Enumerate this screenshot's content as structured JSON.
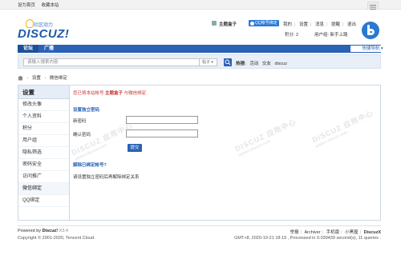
{
  "topbar": {
    "links": [
      "设为首页",
      "收藏本站"
    ]
  },
  "logo": {
    "brand": "DISCUZ!",
    "subtitle": "社区动力"
  },
  "user": {
    "name": "主题盒子",
    "qq_bind": "QQ帐号绑定",
    "links": [
      "我的",
      "设置",
      "消息",
      "提醒",
      "退出"
    ],
    "points_label": "积分: 2",
    "group_label": "用户组: 新手上路"
  },
  "nav": {
    "items": [
      "论坛",
      "广播"
    ],
    "quick_nav": "快捷导航"
  },
  "search": {
    "placeholder": "请输入搜索内容",
    "select": "帖子",
    "hot_label": "热搜:",
    "hot_items": [
      "活动",
      "交友",
      "discuz"
    ]
  },
  "breadcrumb": {
    "items": [
      "设置",
      "微信绑定"
    ],
    "sep": "›"
  },
  "sidebar": {
    "title": "设置",
    "items": [
      "修改头像",
      "个人资料",
      "积分",
      "用户组",
      "隐私筛选",
      "密码安全",
      "访问推广",
      "微信绑定",
      "QQ绑定"
    ],
    "active_index": 7
  },
  "content": {
    "notice_prefix": "您已将本站帐号",
    "notice_user": "主题盒子",
    "notice_suffix": "与微信绑定",
    "section1_title": "设置独立密码",
    "new_pw_label": "新密码",
    "confirm_pw_label": "确认密码",
    "submit_label": "提交",
    "section2_title": "解除已绑定帐号?",
    "hint": "请设置独立密码后再解除绑定关系"
  },
  "watermark": {
    "text": "DISCUZ 应用中心",
    "sub": "addon.discuz.com"
  },
  "footer": {
    "powered_prefix": "Powered by",
    "powered_brand": "Discuz!",
    "version": "X3.4",
    "copyright": "Copyright © 2001-2020, Tencent Cloud.",
    "links": [
      "举报",
      "Archiver",
      "手机版",
      "小黑屋",
      "DiscuzX"
    ],
    "stats": "GMT+8, 2020-10-21 18:19 , Processed in 0.039439 second(s), 11 queries ."
  },
  "colors": {
    "accent": "#2a62b6",
    "notice": "#cc3333"
  }
}
